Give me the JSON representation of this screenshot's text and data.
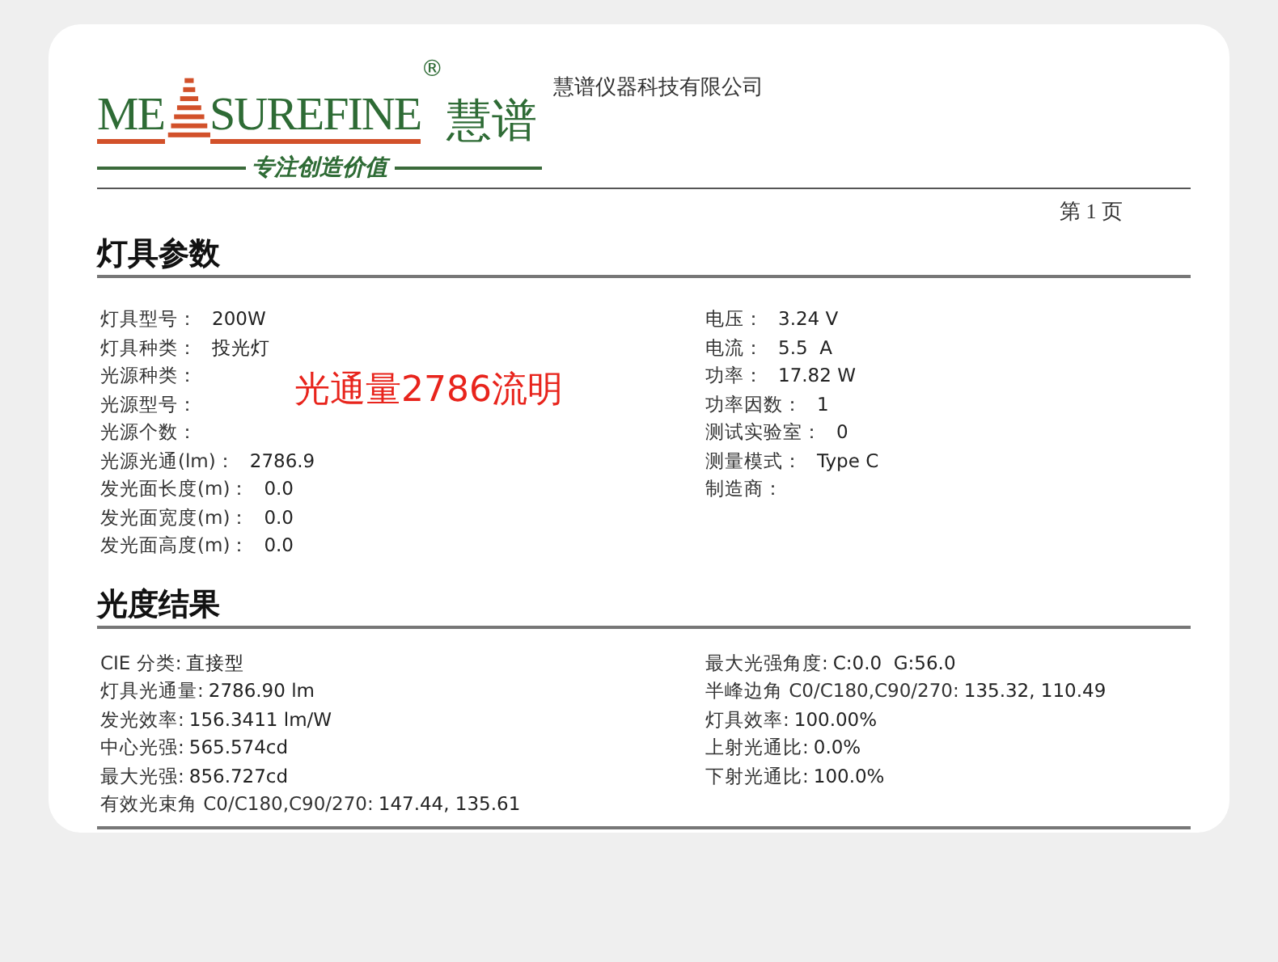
{
  "logo": {
    "left": "ME",
    "right": "SUREFINE",
    "mark": "®",
    "brand": "慧谱",
    "tagline": "专注创造价值"
  },
  "company": "慧谱仪器科技有限公司",
  "page": "第 1 页",
  "sections": [
    {
      "title": "灯具参数",
      "kind": "spaced",
      "left": [
        {
          "label": "灯具型号：",
          "value": "200W"
        },
        {
          "label": "灯具种类：",
          "value": "投光灯"
        },
        {
          "label": "光源种类："
        },
        {
          "label": "光源型号："
        },
        {
          "label": "光源个数："
        },
        {
          "label": "光源光通(lm)：",
          "value": "2786.9"
        },
        {
          "label": "发光面长度(m)：",
          "value": "0.0"
        },
        {
          "label": "发光面宽度(m)：",
          "value": "0.0"
        },
        {
          "label": "发光面高度(m)：",
          "value": "0.0"
        }
      ],
      "right": [
        {
          "label": "电压：",
          "value": "3.24 V"
        },
        {
          "label": "电流：",
          "value": "5.5  A"
        },
        {
          "label": "功率：",
          "value": "17.82 W"
        },
        {
          "label": "功率因数：",
          "value": "1"
        },
        {
          "label": "测试实验室：",
          "value": "0"
        },
        {
          "label": "测量模式：",
          "value": "Type C"
        },
        {
          "label": "制造商："
        }
      ],
      "annotation": "光通量2786流明"
    },
    {
      "title": "光度结果",
      "kind": "tight",
      "left": [
        {
          "label": "CIE 分类:",
          "value": "直接型"
        },
        {
          "label": "灯具光通量:",
          "value": "2786.90 lm"
        },
        {
          "label": "发光效率:",
          "value": "156.3411 lm/W"
        },
        {
          "label": "中心光强:",
          "value": "565.574cd"
        },
        {
          "label": "最大光强:",
          "value": "856.727cd"
        },
        {
          "label": "有效光束角 C0/C180,C90/270:",
          "value": "147.44, 135.61"
        }
      ],
      "right": [
        {
          "label": "最大光强角度:",
          "value": "C:0.0  G:56.0"
        },
        {
          "label": "半峰边角 C0/C180,C90/270:",
          "value": "135.32, 110.49"
        },
        {
          "label": "灯具效率:",
          "value": "100.00%"
        },
        {
          "label": "上射光通比:",
          "value": "0.0%"
        },
        {
          "label": "下射光通比:",
          "value": "100.0%"
        }
      ]
    }
  ]
}
